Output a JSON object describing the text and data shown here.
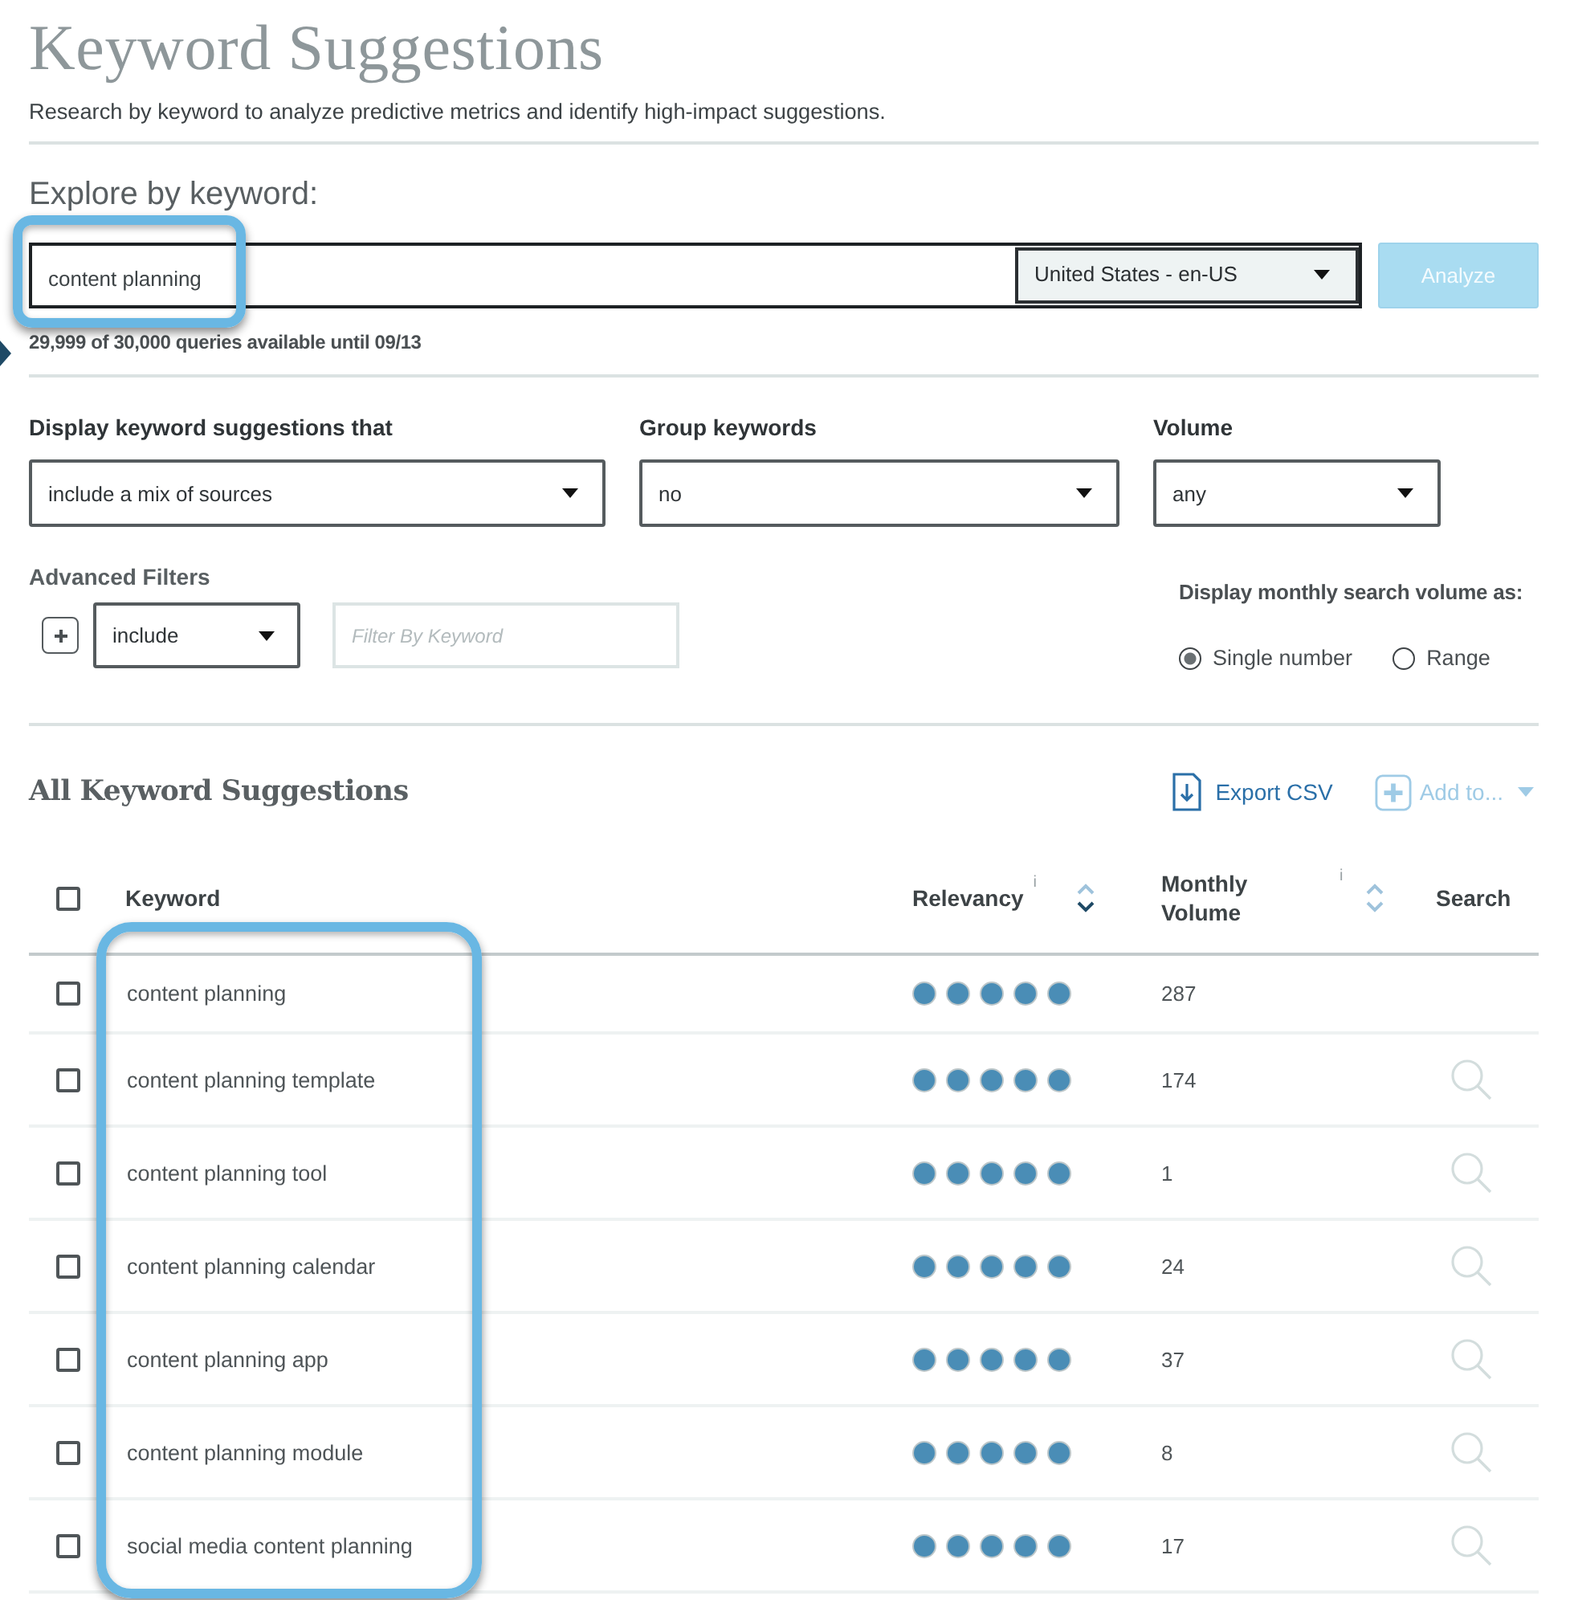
{
  "header": {
    "title": "Keyword Suggestions",
    "subtitle": "Research by keyword to analyze predictive metrics and identify high-impact suggestions."
  },
  "explore": {
    "label": "Explore by keyword:",
    "keyword_input": {
      "value": "content planning",
      "highlighted": true
    },
    "locale_select": {
      "value": "United States - en-US"
    },
    "analyze_button": {
      "label": "Analyze",
      "disabled": true
    },
    "quota": "29,999 of 30,000 queries available until 09/13"
  },
  "filters": {
    "selects": [
      {
        "label": "Display keyword suggestions that",
        "value": "include a mix of sources"
      },
      {
        "label": "Group keywords",
        "value": "no"
      },
      {
        "label": "Volume",
        "value": "any"
      }
    ],
    "advanced": {
      "label": "Advanced Filters",
      "mode_select": {
        "value": "include"
      },
      "keyword_filter": {
        "placeholder": "Filter By Keyword"
      }
    },
    "volume_display": {
      "label": "Display monthly search volume as:",
      "options": [
        {
          "label": "Single number",
          "selected": true
        },
        {
          "label": "Range",
          "selected": false
        }
      ]
    }
  },
  "results": {
    "title": "All Keyword Suggestions",
    "actions": [
      {
        "kind": "export",
        "label": "Export CSV",
        "disabled": false
      },
      {
        "kind": "add",
        "label": "Add to...",
        "disabled": true
      }
    ],
    "table": {
      "select_all": {
        "checked": false
      },
      "keyword_column_highlighted": true,
      "columns": [
        {
          "label": "Keyword"
        },
        {
          "label": "Relevancy",
          "info": "i",
          "sorted": true
        },
        {
          "label": "Monthly Volume",
          "info": "i",
          "sorted": false
        },
        {
          "label": "Search"
        }
      ],
      "rows": [
        {
          "checked": false,
          "keyword": "content planning",
          "stars": 5,
          "volume": "287",
          "search_icon": false
        },
        {
          "checked": false,
          "keyword": "content planning template",
          "stars": 5,
          "volume": "174",
          "search_icon": true
        },
        {
          "checked": false,
          "keyword": "content planning tool",
          "stars": 5,
          "volume": "1",
          "search_icon": true
        },
        {
          "checked": false,
          "keyword": "content planning calendar",
          "stars": 5,
          "volume": "24",
          "search_icon": true
        },
        {
          "checked": false,
          "keyword": "content planning app",
          "stars": 5,
          "volume": "37",
          "search_icon": true
        },
        {
          "checked": false,
          "keyword": "content planning module",
          "stars": 5,
          "volume": "8",
          "search_icon": true
        },
        {
          "checked": false,
          "keyword": "social media content planning",
          "stars": 5,
          "volume": "17",
          "search_icon": true
        }
      ]
    }
  }
}
